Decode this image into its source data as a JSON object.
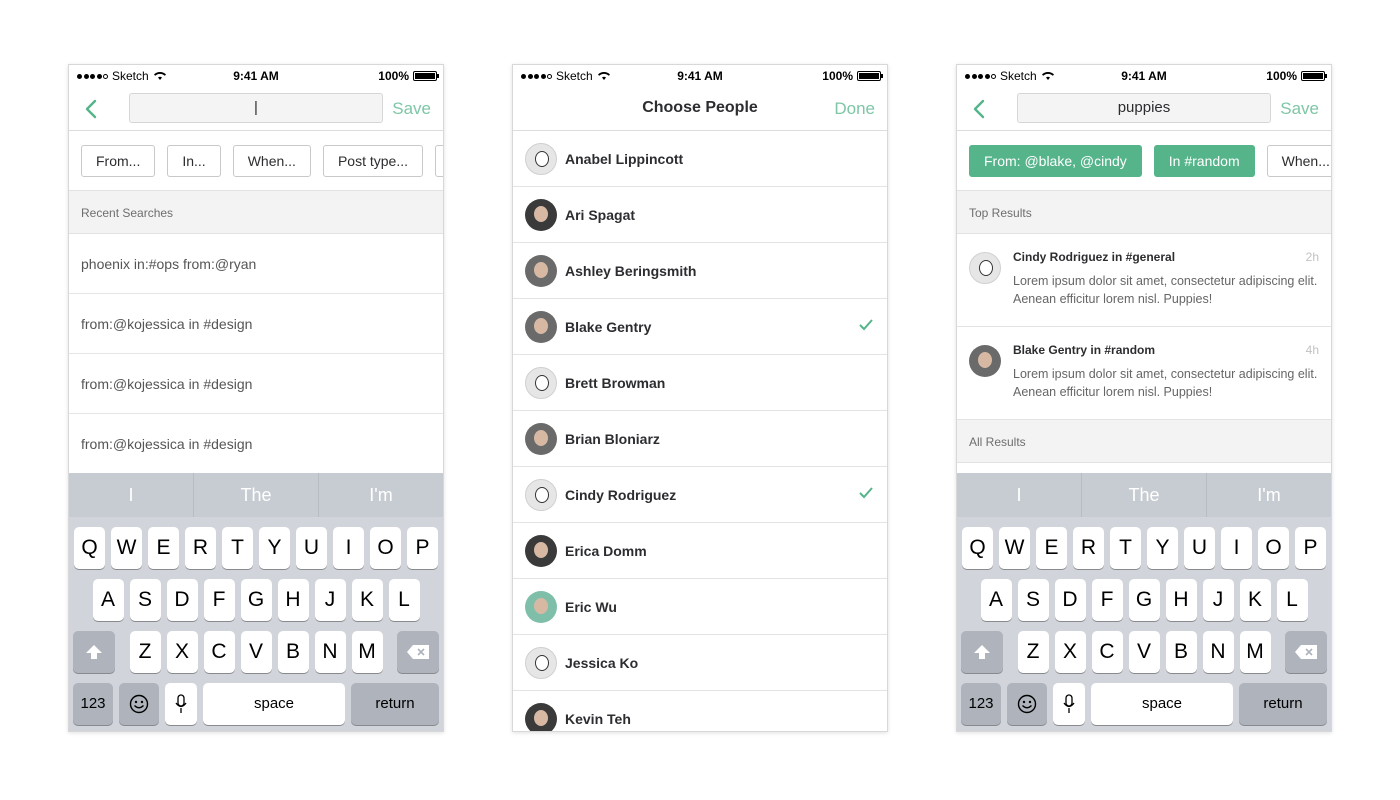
{
  "status": {
    "carrier": "Sketch",
    "time": "9:41 AM",
    "battery": "100%"
  },
  "keyboard": {
    "suggestions": [
      "I",
      "The",
      "I'm"
    ],
    "row1": [
      "Q",
      "W",
      "E",
      "R",
      "T",
      "Y",
      "U",
      "I",
      "O",
      "P"
    ],
    "row2": [
      "A",
      "S",
      "D",
      "F",
      "G",
      "H",
      "J",
      "K",
      "L"
    ],
    "row3": [
      "Z",
      "X",
      "C",
      "V",
      "B",
      "N",
      "M"
    ],
    "numbers_label": "123",
    "space_label": "space",
    "return_label": "return"
  },
  "screen1": {
    "search_value": "|",
    "save_label": "Save",
    "chips": [
      "From...",
      "In...",
      "When...",
      "Post type..."
    ],
    "section_title": "Recent Searches",
    "recent": [
      "phoenix in:#ops from:@ryan",
      "from:@kojessica in #design",
      "from:@kojessica in #design",
      "from:@kojessica in #design"
    ]
  },
  "screen2": {
    "title": "Choose People",
    "done_label": "Done",
    "people": [
      {
        "name": "Anabel Lippincott",
        "selected": false
      },
      {
        "name": "Ari Spagat",
        "selected": false
      },
      {
        "name": "Ashley Beringsmith",
        "selected": false
      },
      {
        "name": "Blake Gentry",
        "selected": true
      },
      {
        "name": "Brett Browman",
        "selected": false
      },
      {
        "name": "Brian Bloniarz",
        "selected": false
      },
      {
        "name": "Cindy Rodriguez",
        "selected": true
      },
      {
        "name": "Erica Domm",
        "selected": false
      },
      {
        "name": "Eric Wu",
        "selected": false
      },
      {
        "name": "Jessica Ko",
        "selected": false
      },
      {
        "name": "Kevin Teh",
        "selected": false
      }
    ]
  },
  "screen3": {
    "search_value": "puppies",
    "save_label": "Save",
    "chips": [
      "From: @blake, @cindy",
      "In #random",
      "When..."
    ],
    "top_results_title": "Top Results",
    "results": [
      {
        "header": "Cindy Rodriguez in #general",
        "time": "2h",
        "body": "Lorem ipsum dolor sit amet, consectetur adipiscing elit. Aenean efficitur lorem nisl. Puppies!"
      },
      {
        "header": "Blake Gentry in #random",
        "time": "4h",
        "body": "Lorem ipsum dolor sit amet, consectetur adipiscing elit. Aenean efficitur lorem nisl. Puppies!"
      }
    ],
    "all_results_title": "All Results"
  },
  "colors": {
    "accent": "#55b48a",
    "accent_text": "#7ec6a6",
    "keyboard_bg": "#d1d5db"
  }
}
